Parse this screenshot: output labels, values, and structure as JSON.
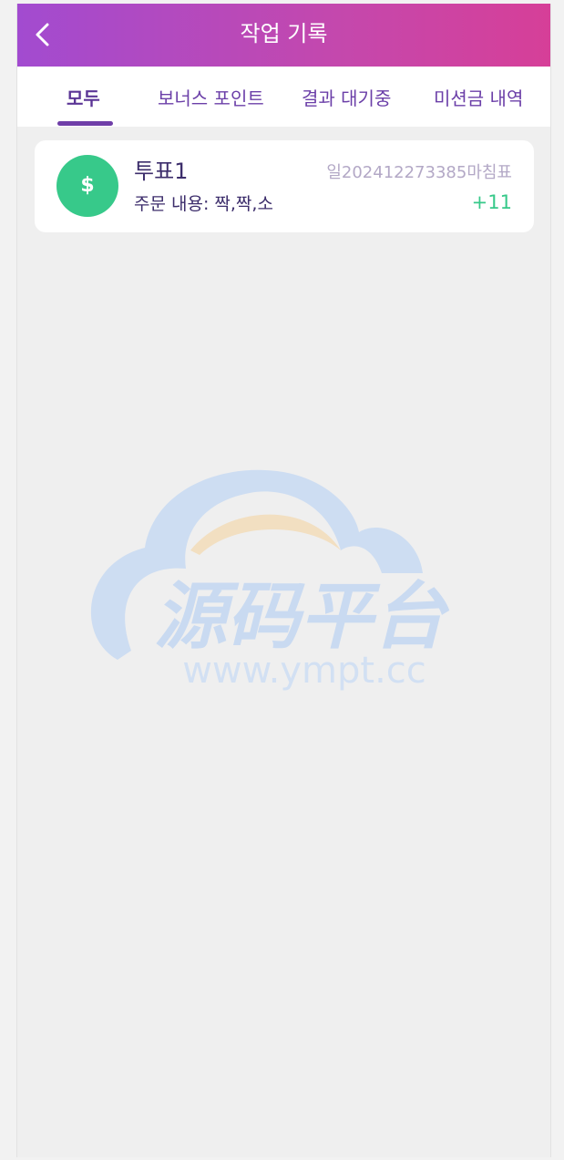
{
  "header": {
    "title": "작업 기록",
    "back_icon": "chevron-left-icon",
    "gradient": [
      "#a24bd0",
      "#d63f98"
    ]
  },
  "tabs": [
    {
      "label": "모두",
      "active": true
    },
    {
      "label": "보너스 포인트",
      "active": false
    },
    {
      "label": "결과 대기중",
      "active": false
    },
    {
      "label": "미션금 내역",
      "active": false
    }
  ],
  "records": [
    {
      "icon": "dollar-coin-icon",
      "icon_symbol": "$",
      "title": "투표1",
      "issue": "일202412273385마침표",
      "content": "주문 내용:  짝,짝,소",
      "amount": "+11",
      "amount_color": "#37c98a"
    }
  ],
  "watermark": {
    "brand": "源码平台",
    "url": "www.ympt.cc"
  }
}
